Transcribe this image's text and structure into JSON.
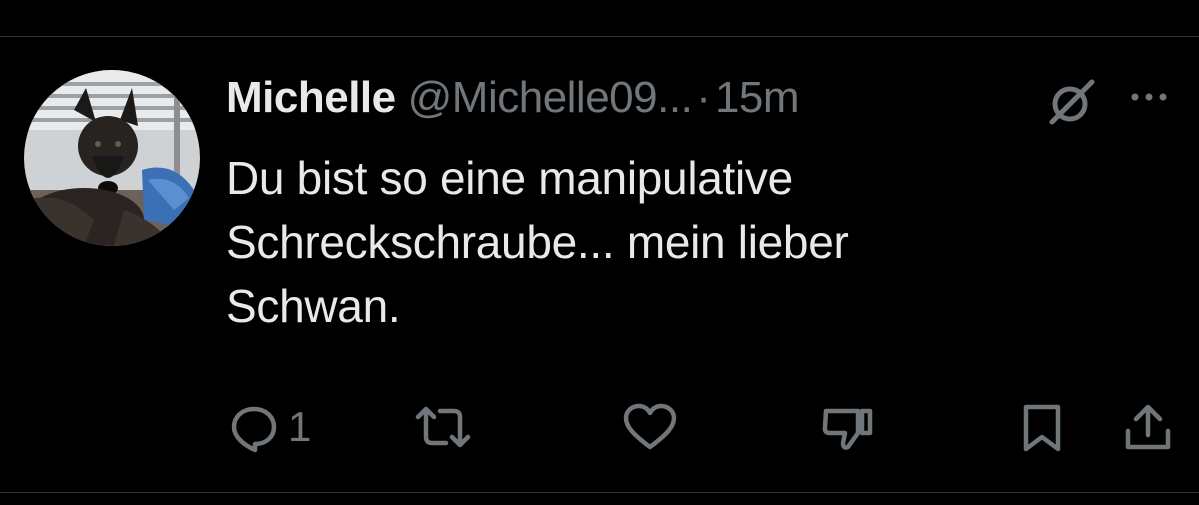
{
  "tweet": {
    "author_name": "Michelle",
    "author_handle": "@Michelle09...",
    "separator": "·",
    "timestamp": "15m",
    "text_lines": [
      "Du bist so eine manipulative",
      "Schreckschraube... mein lieber",
      "Schwan."
    ]
  },
  "actions": {
    "reply_count": "1"
  },
  "icons": {
    "grok": "grok-icon",
    "more": "more-icon",
    "reply": "reply-icon",
    "retweet": "retweet-icon",
    "like": "heart-icon",
    "dislike": "thumbs-down-icon",
    "bookmark": "bookmark-icon",
    "share": "share-icon"
  },
  "colors": {
    "background": "#000000",
    "primary_text": "#e7e9ea",
    "secondary_text": "#71767b",
    "divider": "#2f3336"
  }
}
